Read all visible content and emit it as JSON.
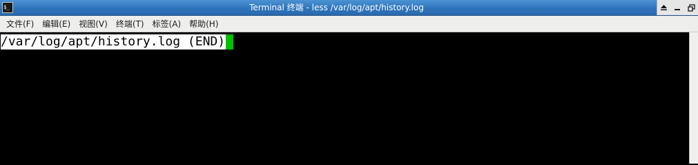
{
  "window": {
    "title": "Terminal 终端 - less /var/log/apt/history.log",
    "app_icon_glyph": "$_"
  },
  "controls": {
    "shade_glyph": "⏏",
    "minimize_glyph": "_",
    "maximize_glyph": "▫",
    "close_glyph": "x"
  },
  "menu": {
    "items": [
      {
        "label": "文件(F)"
      },
      {
        "label": "编辑(E)"
      },
      {
        "label": "视图(V)"
      },
      {
        "label": "终端(T)"
      },
      {
        "label": "标签(A)"
      },
      {
        "label": "帮助(H)"
      }
    ]
  },
  "terminal": {
    "status_line": "/var/log/apt/history.log (END)",
    "cursor_color": "#00c000"
  },
  "colors": {
    "titlebar": "#2f74bd",
    "background": "#000000",
    "menubar": "#eeeeec"
  }
}
